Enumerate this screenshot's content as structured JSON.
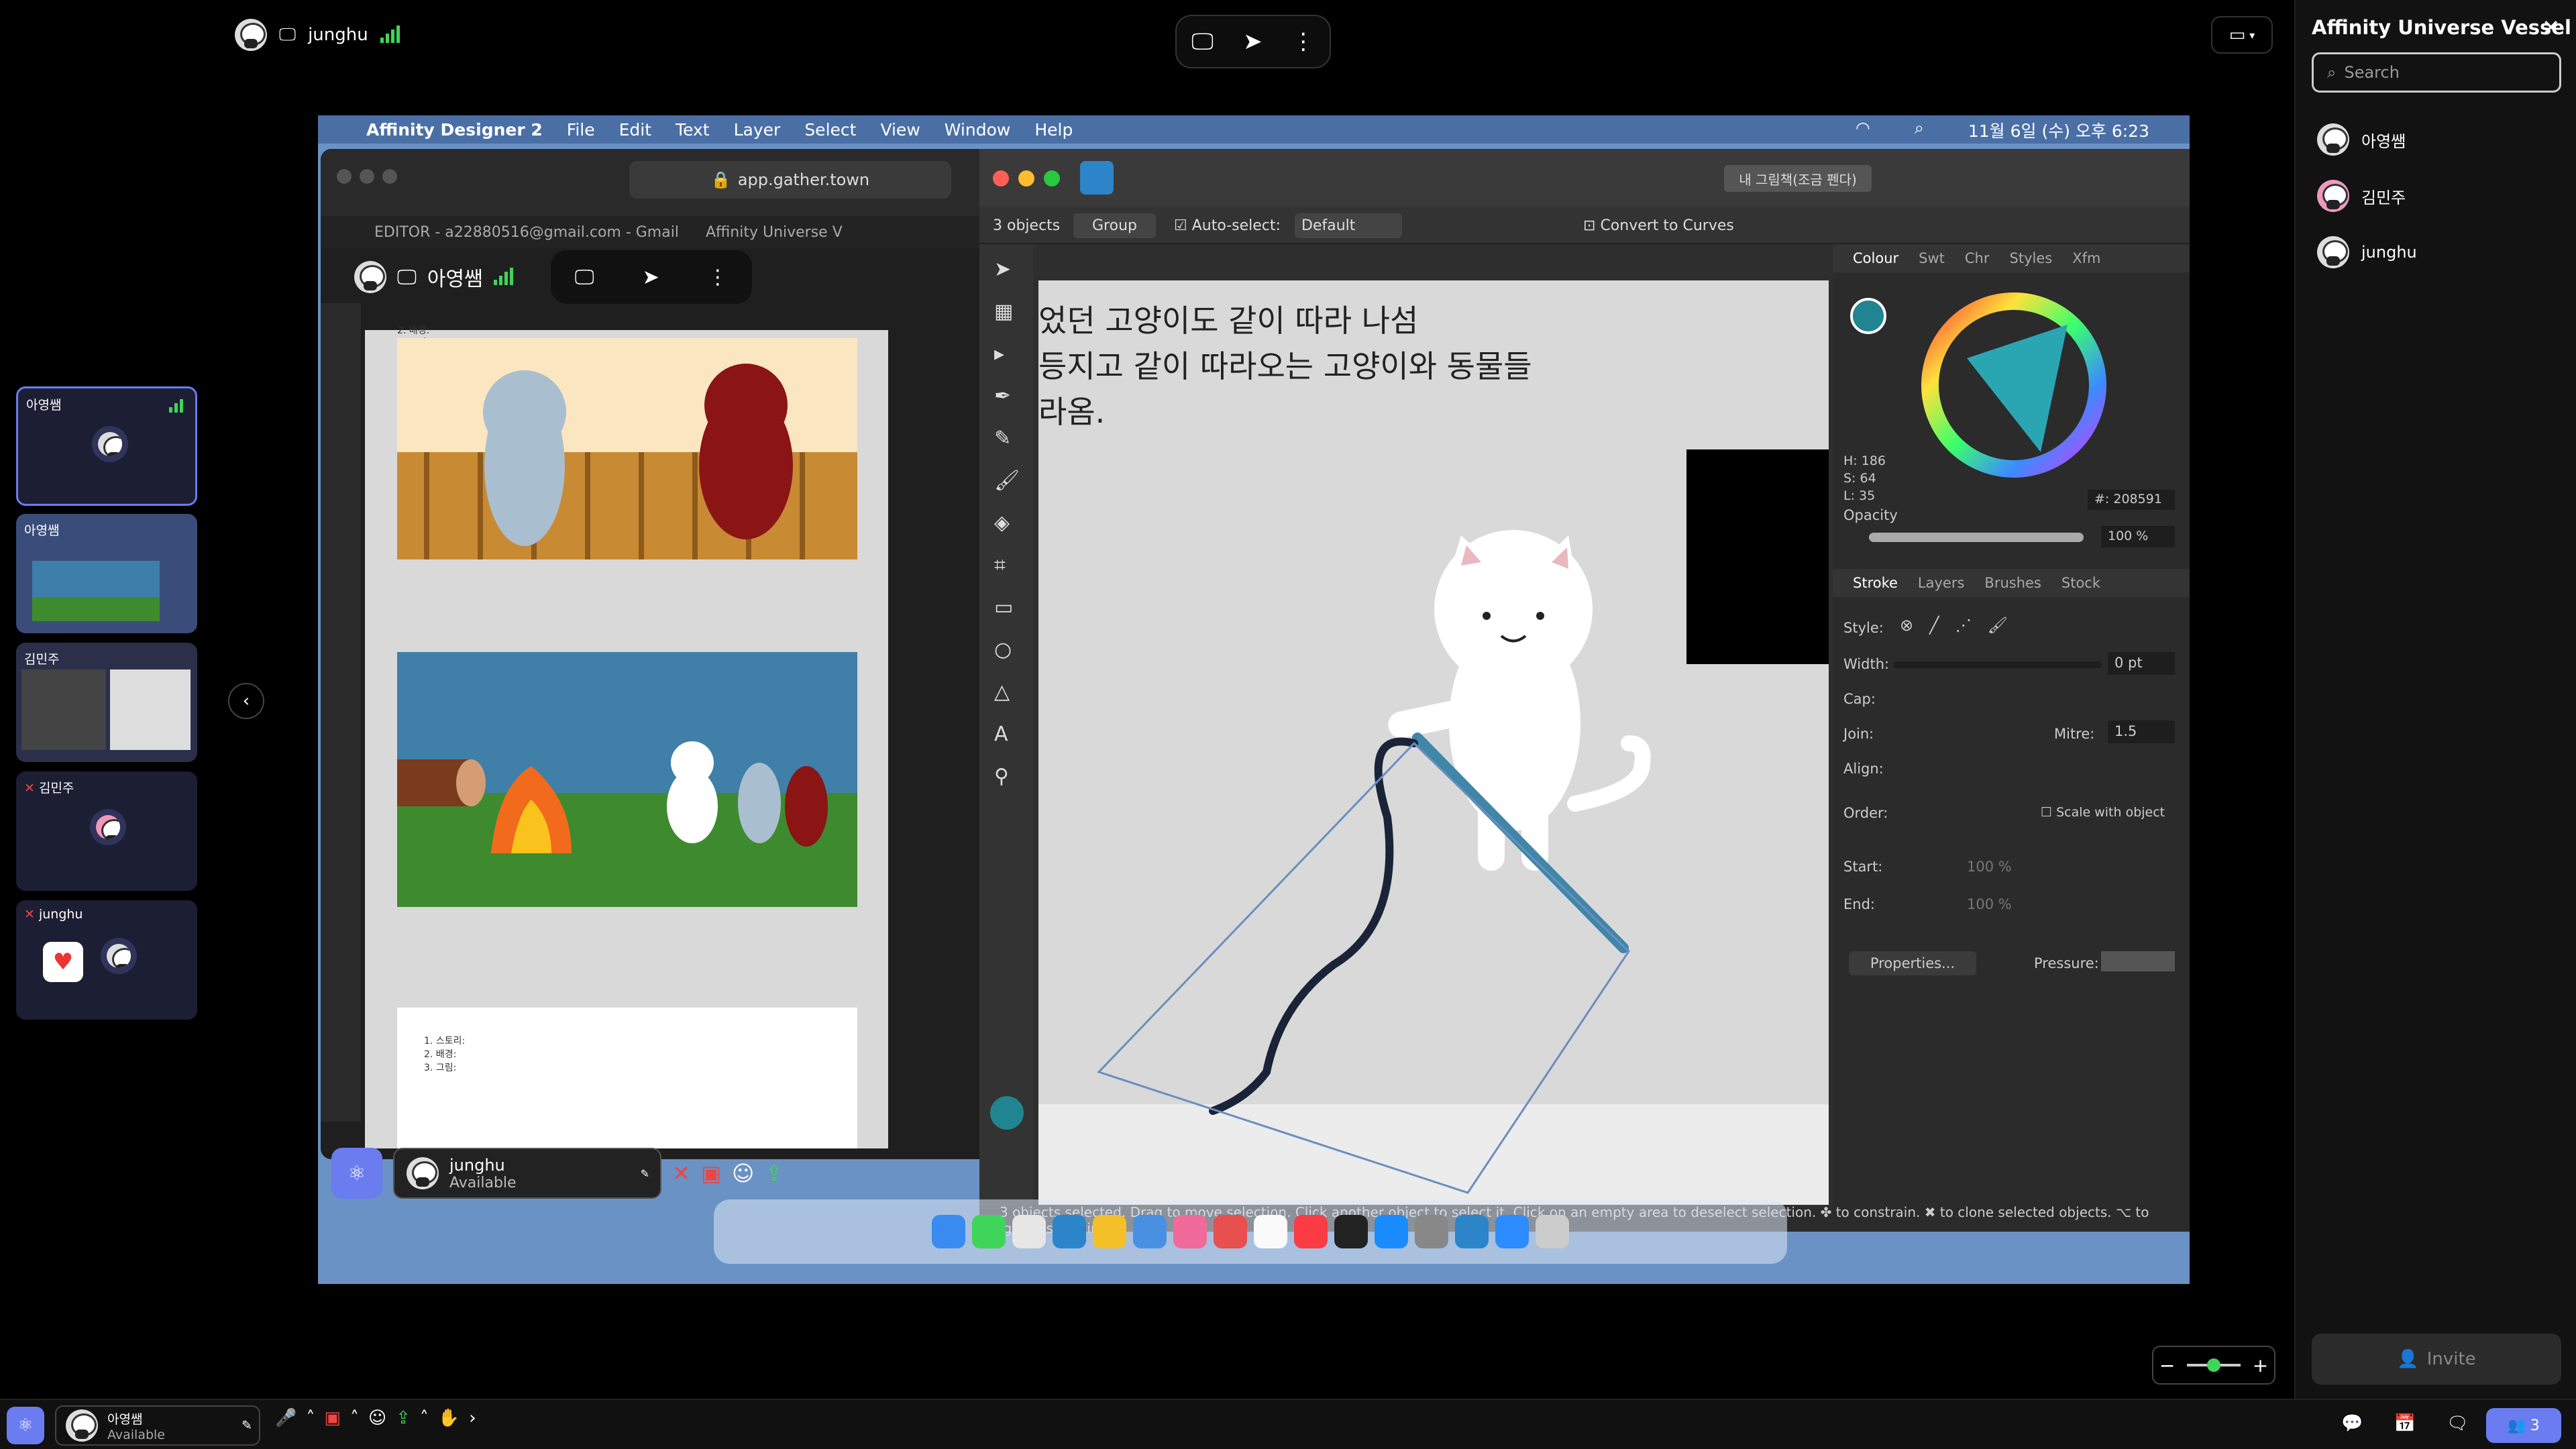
{
  "top_bar": {
    "user_name": "junghu",
    "control_icons": [
      "screen-share-icon",
      "cursor-icon",
      "more-icon"
    ]
  },
  "right_panel": {
    "title": "Affinity Universe Vessel",
    "search_placeholder": "Search",
    "participants": [
      "아영쌤",
      "김민주",
      "junghu"
    ],
    "invite_label": "Invite"
  },
  "tiles": [
    {
      "name": "아영쌤"
    },
    {
      "name": "아영쌤"
    },
    {
      "name": "김민주"
    },
    {
      "name": "김민주"
    },
    {
      "name": "junghu"
    }
  ],
  "mac_menu": {
    "app": "Affinity Designer 2",
    "items": [
      "File",
      "Edit",
      "Text",
      "Layer",
      "Select",
      "View",
      "Window",
      "Help"
    ],
    "clock": "11월 6일 (수) 오후 6:23"
  },
  "browser": {
    "url": "app.gather.town",
    "tabs": [
      "EDITOR - a22880516@gmail.com - Gmail",
      "Affinity Universe V"
    ],
    "gather_user": "아영쌤",
    "footer_user": "junghu",
    "footer_status": "Available",
    "doc_lines_a": [
      "1. 스토리:",
      "2. 배경:",
      "3. 그림:"
    ]
  },
  "designer": {
    "selection_info": "3 objects",
    "group_label": "Group",
    "auto_select_label": "Auto-select:",
    "auto_select_value": "Default",
    "convert_label": "Convert to Curves",
    "preset_label": "내 그림책(조금 펜다)",
    "canvas_text": [
      "었던 고양이도 같이 따라 나섬",
      "등지고 같이 따라오는 고양이와 동물들",
      "라옴."
    ],
    "colour_tabs": [
      "Colour",
      "Swt",
      "Chr",
      "Styles",
      "Xfm"
    ],
    "hsl": [
      "H: 186",
      "S: 64",
      "L: 35"
    ],
    "hex": "208591",
    "opacity_label": "Opacity",
    "opacity_value": "100 %",
    "stroke_tabs": [
      "Stroke",
      "Layers",
      "Brushes",
      "Stock"
    ],
    "style_label": "Style:",
    "width_label": "Width:",
    "width_value": "0 pt",
    "cap_label": "Cap:",
    "join_label": "Join:",
    "mitre_label": "Mitre:",
    "mitre_value": "1.5",
    "align_label": "Align:",
    "order_label": "Order:",
    "scale_label": "Scale with object",
    "start_label": "Start:",
    "start_value": "100 %",
    "end_label": "End:",
    "end_value": "100 %",
    "properties_label": "Properties...",
    "pressure_label": "Pressure:",
    "status_text": "3 objects selected. Drag to move selection. Click another object to select it. Click on an empty area to deselect selection. ✤ to constrain. ✖ to clone selected objects. ⌥ to ignore snapping",
    "fill_color": "#208591"
  },
  "bottom_bar": {
    "user_name": "아영쌤",
    "status": "Available",
    "people_count": "3"
  },
  "colors": {
    "accent": "#6a7cf0",
    "signal": "#3fd55a",
    "desktop": "#6a92c4"
  }
}
